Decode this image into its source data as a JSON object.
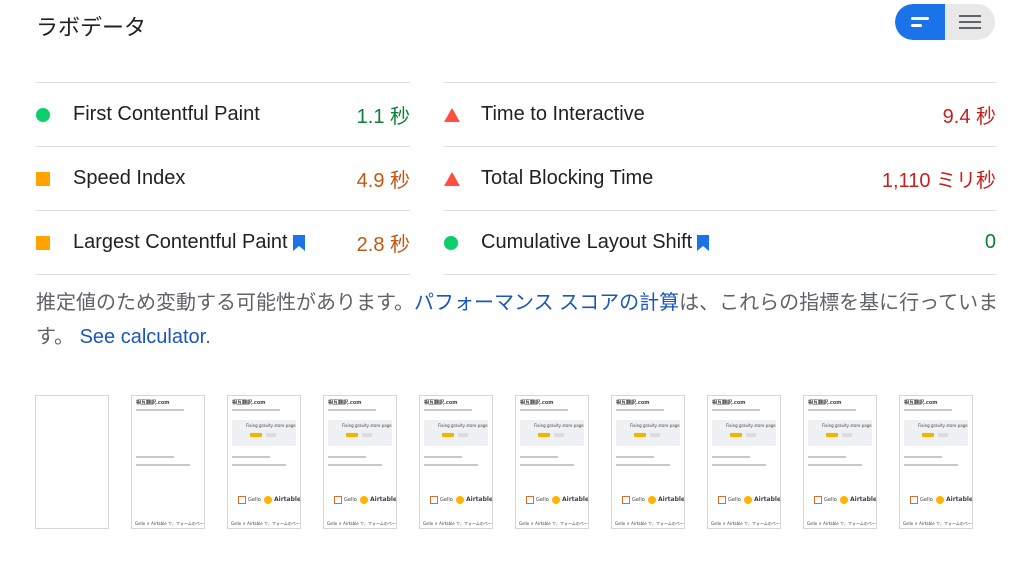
{
  "section_title": "ラボデータ",
  "view_toggle": {
    "options": [
      "bar-chart-view-icon",
      "list-view-icon"
    ],
    "active": 0,
    "accent": "#1a73e8"
  },
  "metrics": [
    {
      "label": "First Contentful Paint",
      "value": "1.1 秒",
      "status": "good",
      "indicator": "circle-green",
      "bookmark": false
    },
    {
      "label": "Time to Interactive",
      "value": "9.4 秒",
      "status": "bad",
      "indicator": "triangle-red",
      "bookmark": false
    },
    {
      "label": "Speed Index",
      "value": "4.9 秒",
      "status": "average",
      "indicator": "square-orange",
      "bookmark": false
    },
    {
      "label": "Total Blocking Time",
      "value": "1,110 ミリ秒",
      "status": "bad",
      "indicator": "triangle-red",
      "bookmark": false
    },
    {
      "label": "Largest Contentful Paint",
      "value": "2.8 秒",
      "status": "average",
      "indicator": "square-orange",
      "bookmark": true
    },
    {
      "label": "Cumulative Layout Shift",
      "value": "0",
      "status": "good",
      "indicator": "circle-green",
      "bookmark": true
    }
  ],
  "colors": {
    "good": "#0c8036",
    "average": "#c2570f",
    "bad": "#c5221f",
    "good_icon": "#0cce6b",
    "average_icon": "#ffa400",
    "bad_icon": "#ff4e42",
    "link": "#1a56c0"
  },
  "description": {
    "text_before": "推定値のため変動する可能性があります。",
    "link1": "パフォーマンス スコアの計算",
    "text_middle": "は、これらの指標を基に行っています。",
    "link2": "See calculator",
    "text_after": "."
  },
  "filmstrip": {
    "frame_count": 10,
    "frame_site_title": "相互翻訳.com",
    "frame_headline": "Fixing gravity store page",
    "frame_brands": [
      "Gello",
      "Airtable"
    ],
    "frame_footer": "Gello × Airtable で、フォームのページを作成"
  }
}
